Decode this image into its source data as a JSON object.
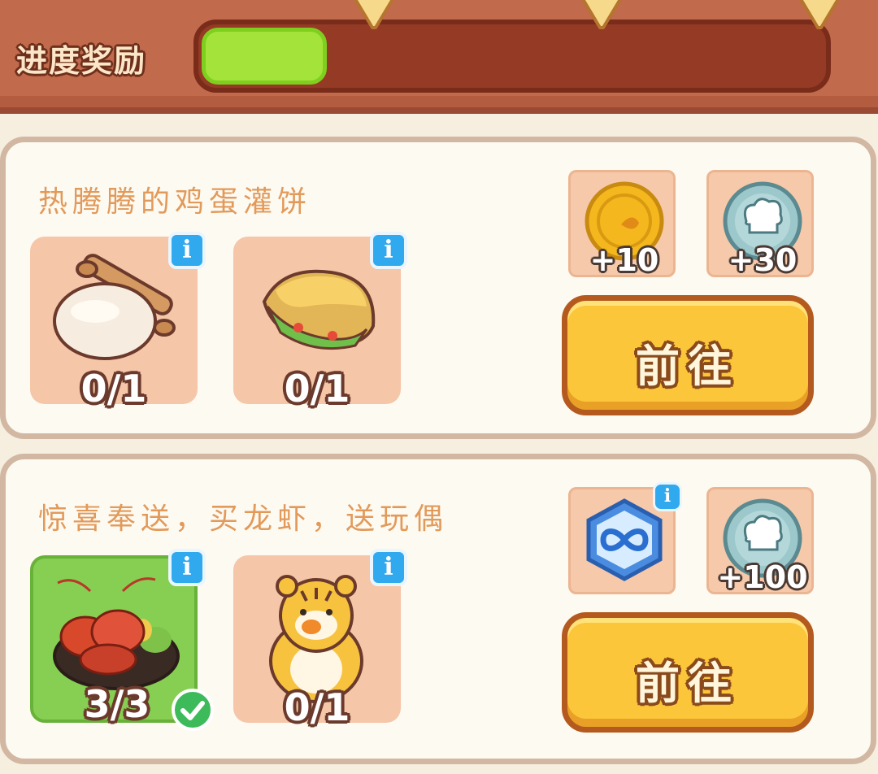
{
  "progress": {
    "label": "进度奖励",
    "fill_fraction": 0.2
  },
  "colors": {
    "accent_button": "#fcc63a",
    "complete_slot": "#86cf52",
    "info_badge": "#31a9ef"
  },
  "quests": [
    {
      "title": "热腾腾的鸡蛋灌饼",
      "items": [
        {
          "icon": "dough-rolling-pin-icon",
          "count": "0/1",
          "done": false
        },
        {
          "icon": "egg-pancake-icon",
          "count": "0/1",
          "done": false
        }
      ],
      "rewards": [
        {
          "icon": "gold-coin-icon",
          "amount": "+10"
        },
        {
          "icon": "chef-hat-token-icon",
          "amount": "+30"
        }
      ],
      "button_label": "前往"
    },
    {
      "title": "惊喜奉送，买龙虾，送玩偶",
      "items": [
        {
          "icon": "crayfish-plate-icon",
          "count": "3/3",
          "done": true
        },
        {
          "icon": "tiger-plush-icon",
          "count": "0/1",
          "done": false
        }
      ],
      "rewards": [
        {
          "icon": "infinity-crystal-icon",
          "amount": ""
        },
        {
          "icon": "chef-hat-token-icon",
          "amount": "+100"
        }
      ],
      "button_label": "前往"
    }
  ],
  "info_badge_text": "i"
}
